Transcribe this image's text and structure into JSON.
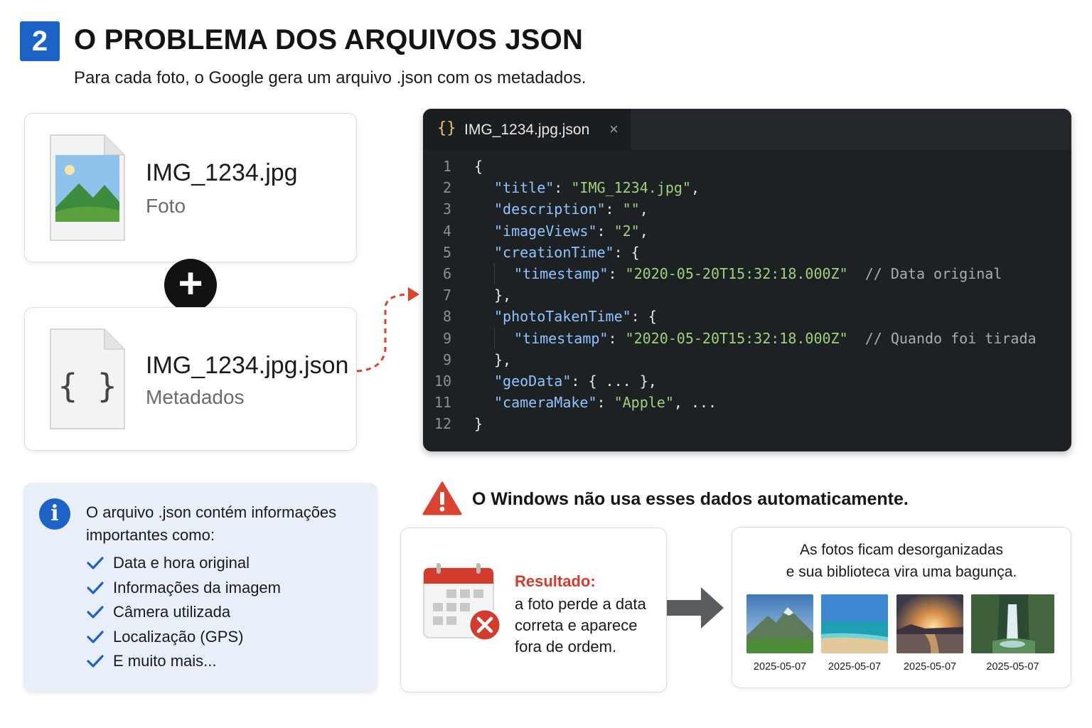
{
  "header": {
    "step_number": "2",
    "title": "O PROBLEMA DOS ARQUIVOS JSON",
    "subtitle": "Para cada foto, o Google gera um arquivo .json com os metadados."
  },
  "files": {
    "photo": {
      "name": "IMG_1234.jpg",
      "type_label": "Foto",
      "icon": "image-file-icon"
    },
    "json": {
      "name": "IMG_1234.jpg.json",
      "type_label": "Metadados",
      "icon": "json-file-icon",
      "icon_glyph": "{ }"
    },
    "plus_glyph": "+"
  },
  "editor": {
    "tab_icon": "{}",
    "tab_label": "IMG_1234.jpg.json",
    "tab_close": "×",
    "lines": [
      {
        "n": "1",
        "text": "{"
      },
      {
        "n": "2",
        "key": "\"title\"",
        "sep": ": ",
        "value": "\"IMG_1234.jpg\"",
        "tail": ","
      },
      {
        "n": "3",
        "key": "\"description\"",
        "sep": ": ",
        "value": "\"\"",
        "tail": ","
      },
      {
        "n": "4",
        "key": "\"imageViews\"",
        "sep": ": ",
        "value": "\"2\"",
        "tail": ","
      },
      {
        "n": "5",
        "key": "\"creationTime\"",
        "sep": ": ",
        "tail": "{"
      },
      {
        "n": "6",
        "key": "\"timestamp\"",
        "sep": ": ",
        "value": "\"2020-05-20T15:32:18.000Z\"",
        "comment": "// Data original"
      },
      {
        "n": "7",
        "text": "},"
      },
      {
        "n": "8",
        "key": "\"photoTakenTime\"",
        "sep": ": ",
        "tail": "{"
      },
      {
        "n": "9",
        "key": "\"timestamp\"",
        "sep": ": ",
        "value": "\"2020-05-20T15:32:18.000Z\"",
        "comment": "// Quando foi tirada"
      },
      {
        "n": "9",
        "text": "},"
      },
      {
        "n": "10",
        "key": "\"geoData\"",
        "sep": ": ",
        "tail": "{ ... },"
      },
      {
        "n": "11",
        "key": "\"cameraMake\"",
        "sep": ": ",
        "value": "\"Apple\"",
        "tail": ", ..."
      },
      {
        "n": "12",
        "text": "}"
      }
    ]
  },
  "info": {
    "icon_glyph": "i",
    "intro": "O arquivo .json contém informações importantes como:",
    "items": [
      "Data e hora original",
      "Informações da imagem",
      "Câmera utilizada",
      "Localização (GPS)",
      "E muito mais..."
    ]
  },
  "warning": {
    "text": "O Windows não usa esses dados automaticamente."
  },
  "result": {
    "title": "Resultado:",
    "body": "a foto perde a data correta e aparece fora de ordem."
  },
  "gallery": {
    "caption_line1": "As fotos ficam desorganizadas",
    "caption_line2": "e sua biblioteca vira uma bagunça.",
    "photos": [
      {
        "date": "2025-05-07",
        "scene": "mountain"
      },
      {
        "date": "2025-05-07",
        "scene": "beach"
      },
      {
        "date": "2025-05-07",
        "scene": "sunset"
      },
      {
        "date": "2025-05-07",
        "scene": "waterfall"
      }
    ]
  },
  "colors": {
    "accent_blue": "#1d63c7",
    "warning_red": "#d33b2c",
    "editor_bg": "#1e2124",
    "json_key": "#8fc5ff",
    "json_string": "#9fd17a"
  }
}
